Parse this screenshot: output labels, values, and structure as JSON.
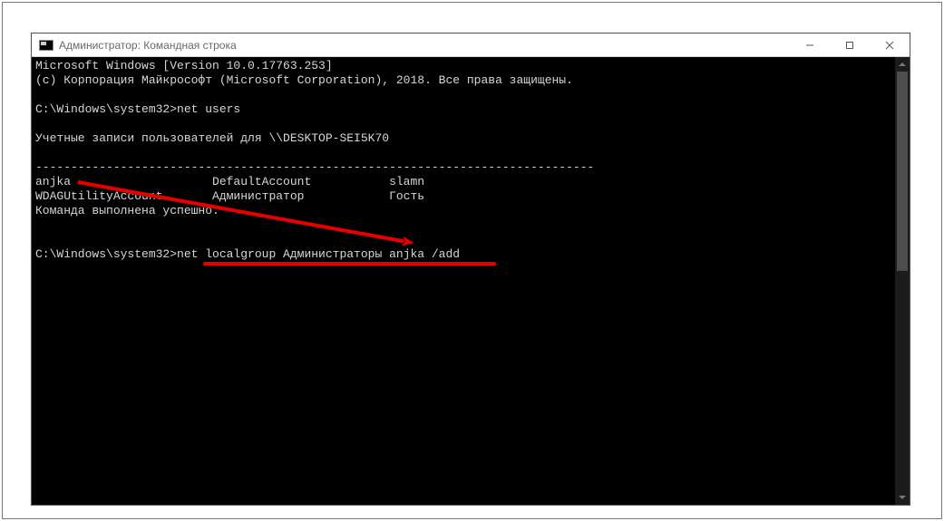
{
  "window": {
    "title": "Администратор: Командная строка"
  },
  "terminal": {
    "lines": [
      "Microsoft Windows [Version 10.0.17763.253]",
      "(c) Корпорация Майкрософт (Microsoft Corporation), 2018. Все права защищены.",
      "",
      "C:\\Windows\\system32>net users",
      "",
      "Учетные записи пользователей для \\\\DESKTOP-SEI5K70",
      "",
      "-------------------------------------------------------------------------------",
      "anjka                    DefaultAccount           slamn",
      "WDAGUtilityAccount       Администратор            Гость",
      "Команда выполнена успешно.",
      "",
      "",
      "C:\\Windows\\system32>net localgroup Администраторы anjka /add"
    ]
  },
  "annotation": {
    "color": "#e20000"
  }
}
